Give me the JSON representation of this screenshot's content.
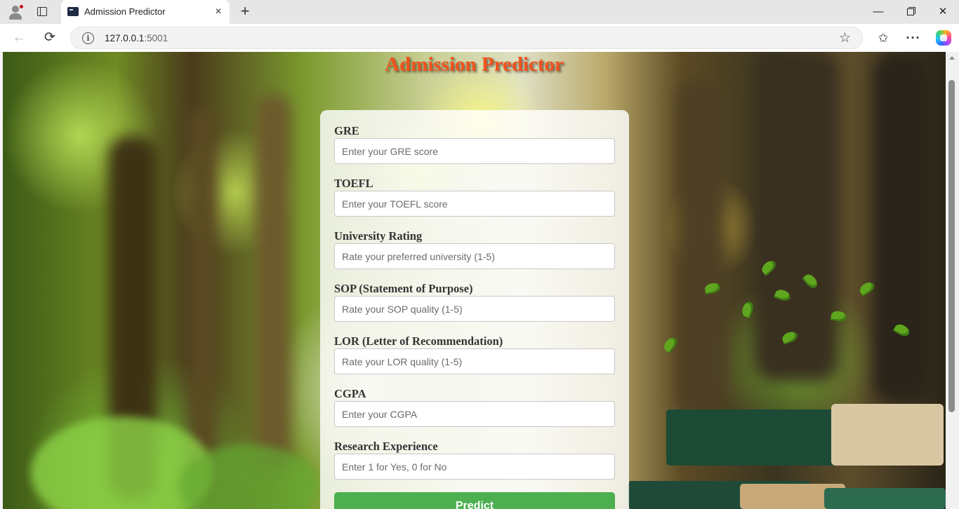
{
  "browser": {
    "tab_title": "Admission Predictor",
    "tab_close_glyph": "×",
    "new_tab_glyph": "+",
    "url_host": "127.0.0.1",
    "url_port": ":5001",
    "back_glyph": "←",
    "reload_glyph": "⟳",
    "star_glyph": "☆",
    "favorites_glyph": "✩",
    "more_glyph": "···",
    "minimize_glyph": "—",
    "close_glyph": "✕"
  },
  "page": {
    "title": "Admission Predictor",
    "title_color": "#f2521c",
    "accent_color": "#4caf50"
  },
  "form": {
    "fields": [
      {
        "label": "GRE",
        "placeholder": "Enter your GRE score"
      },
      {
        "label": "TOEFL",
        "placeholder": "Enter your TOEFL score"
      },
      {
        "label": "University Rating",
        "placeholder": "Rate your preferred university (1-5)"
      },
      {
        "label": "SOP (Statement of Purpose)",
        "placeholder": "Rate your SOP quality (1-5)"
      },
      {
        "label": "LOR (Letter of Recommendation)",
        "placeholder": "Rate your LOR quality (1-5)"
      },
      {
        "label": "CGPA",
        "placeholder": "Enter your CGPA"
      },
      {
        "label": "Research Experience",
        "placeholder": "Enter 1 for Yes, 0 for No"
      }
    ],
    "submit_label": "Predict"
  }
}
